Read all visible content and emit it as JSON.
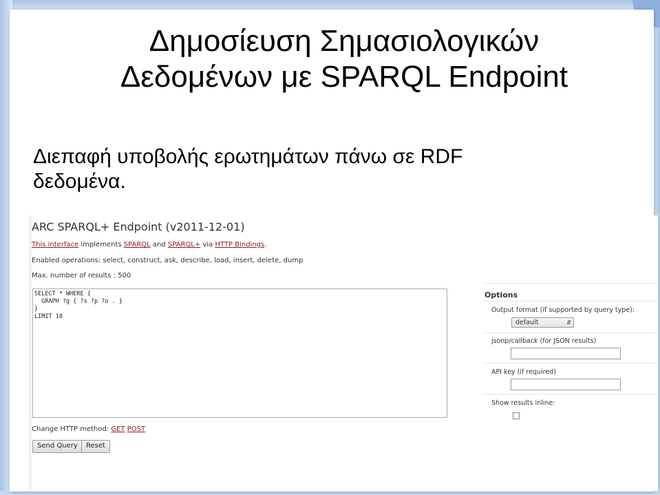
{
  "slide": {
    "title_line1": "Δημοσίευση Σημασιολογικών",
    "title_line2": "Δεδομένων με SPARQL Endpoint",
    "subtitle_line1": "Διεπαφή υποβολής ερωτημάτων πάνω σε RDF",
    "subtitle_line2": "δεδομένα."
  },
  "endpoint": {
    "heading": "ARC SPARQL+ Endpoint (v2011-12-01)",
    "intro": {
      "link1": "This interface",
      "text1": " implements ",
      "link2": "SPARQL",
      "text2": " and ",
      "link3": "SPARQL+",
      "text3": " via ",
      "link4": "HTTP Bindings",
      "text4": "."
    },
    "enabled_ops": "Enabled operations: select, construct, ask, describe, load, insert, delete, dump",
    "max_results": "Max. number of results : 500",
    "query_text": "SELECT * WHERE {\n  GRAPH ?g { ?s ?p ?o . }\n}\nLIMIT 10",
    "http_method": {
      "label": "Change HTTP method: ",
      "get": "GET",
      "post": "POST"
    },
    "buttons": {
      "send": "Send Query",
      "reset": "Reset"
    }
  },
  "options": {
    "title": "Options",
    "output_format_label": "Output format (if supported by query type):",
    "output_format_value": "default",
    "jsonp_label": "jsonp/callback (for JSON results)",
    "api_key_label": "API key (if required)",
    "show_inline_label": "Show results inline:"
  }
}
